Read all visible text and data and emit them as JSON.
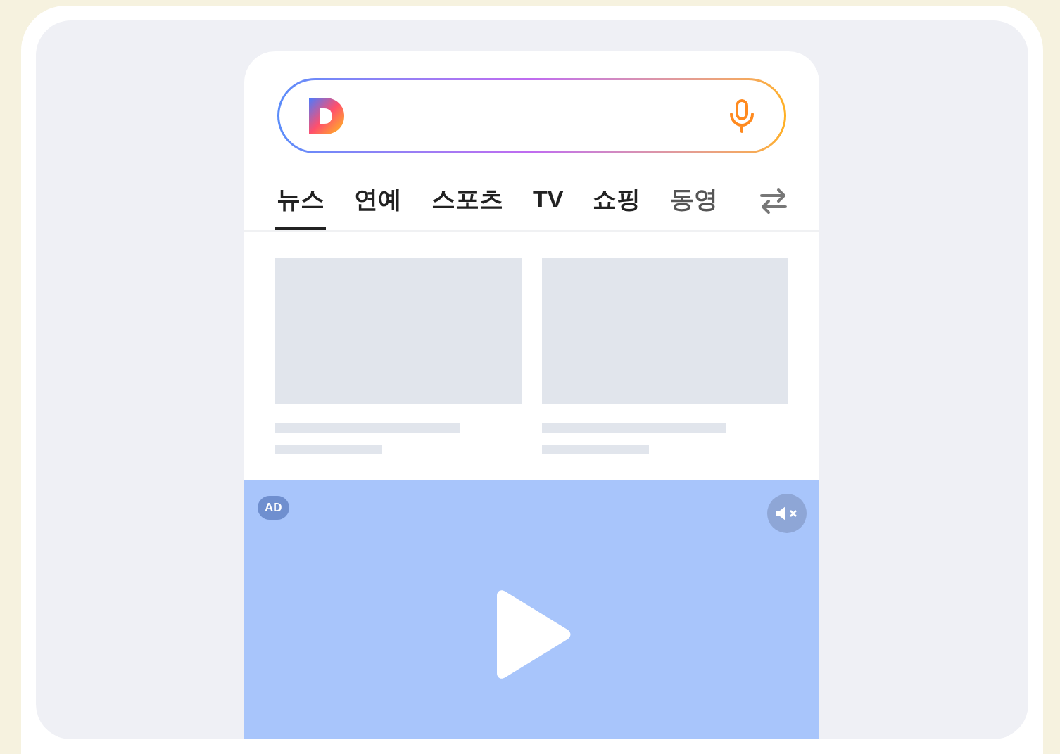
{
  "tabs": [
    {
      "label": "뉴스",
      "selected": true
    },
    {
      "label": "연예",
      "selected": false
    },
    {
      "label": "스포츠",
      "selected": false
    },
    {
      "label": "TV",
      "selected": false
    },
    {
      "label": "쇼핑",
      "selected": false
    },
    {
      "label": "동영",
      "selected": false
    }
  ],
  "ad": {
    "badge": "AD",
    "muted": true
  }
}
